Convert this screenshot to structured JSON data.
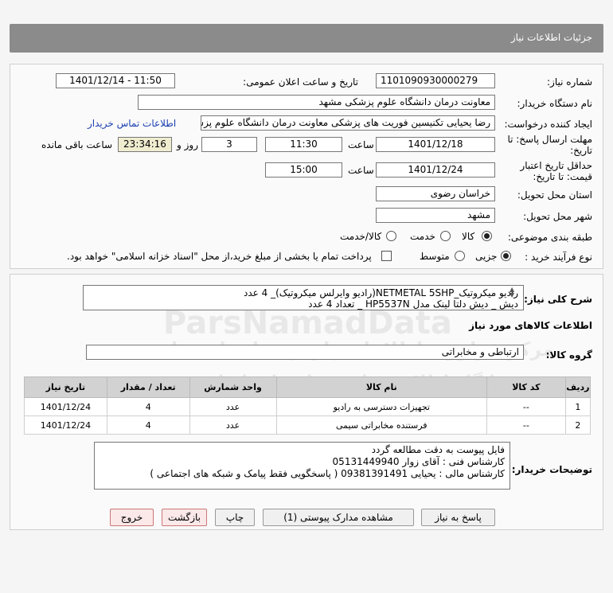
{
  "header": {
    "title": "جزئیات اطلاعات نیاز"
  },
  "form": {
    "need_number_label": "شماره نیاز:",
    "need_number": "1101090930000279",
    "announce_label": "تاریخ و ساعت اعلان عمومی:",
    "announce_value": "1401/12/14 - 11:50",
    "buyer_label": "نام دستگاه خریدار:",
    "buyer_value": "معاونت درمان دانشگاه علوم پزشکی مشهد",
    "creator_label": "ایجاد کننده درخواست:",
    "creator_value": "رضا یحیایی تکنیسین فوریت های پزشکی معاونت درمان دانشگاه علوم پزشکی م",
    "contact_link": "اطلاعات تماس خریدار",
    "deadline_label_1": "مهلت ارسال پاسخ: تا",
    "deadline_label_2": "تاریخ:",
    "deadline_date": "1401/12/18",
    "time_label": "ساعت",
    "deadline_time": "11:30",
    "days_value": "3",
    "days_label": "روز و",
    "remaining_time": "23:34:16",
    "remaining_label": "ساعت باقی مانده",
    "validity_label_1": "حداقل تاریخ اعتبار",
    "validity_label_2": "قیمت: تا تاریخ:",
    "validity_date": "1401/12/24",
    "validity_time_label": "ساعت",
    "validity_time": "15:00",
    "province_label": "استان محل تحویل:",
    "province_value": "خراسان رضوی",
    "city_label": "شهر محل تحویل:",
    "city_value": "مشهد",
    "category_label": "طبقه بندی موضوعی:",
    "category_options": [
      "کالا",
      "خدمت",
      "کالا/خدمت"
    ],
    "process_label": "نوع فرآیند خرید :",
    "process_options": [
      "جزیی",
      "متوسط"
    ],
    "payment_text": "پرداخت تمام یا بخشی از مبلغ خرید،از محل \"اسناد خزانه اسلامی\" خواهد بود."
  },
  "summary": {
    "label": "شرح کلی نیاز:",
    "line1": "رادیو میکروتیک_NETMETAL 5SHP(رادیو وایرلس میکروتیک)_ 4 عدد",
    "line2": "دیش _ دیش دلتا لینک مدل HP5537N _ تعداد 4 عدد"
  },
  "goods": {
    "section_title": "اطلاعات کالاهای مورد نیاز",
    "group_label": "گروه کالا:",
    "group_value": "ارتباطی و مخابراتی",
    "columns": [
      "ردیف",
      "کد کالا",
      "نام کالا",
      "واحد شمارش",
      "تعداد / مقدار",
      "تاریخ نیاز"
    ],
    "rows": [
      [
        "1",
        "--",
        "تجهیزات دسترسی به رادیو",
        "عدد",
        "4",
        "1401/12/24"
      ],
      [
        "2",
        "--",
        "فرستنده مخابراتی سیمی",
        "عدد",
        "4",
        "1401/12/24"
      ]
    ]
  },
  "buyer_notes": {
    "label": "توضیحات خریدار:",
    "line1": "فایل پیوست به دقت مطالعه گردد",
    "line2": "کارشناس فنی : آقای زوار 05131449940",
    "line3": "کارشناس مالی : یحیایی 09381391491 ( پاسخگویی فقط پیامک و شبکه های اجتماعی )"
  },
  "buttons": {
    "reply": "پاسخ به نیاز",
    "attachments": "مشاهده مدارک پیوستی (1)",
    "print": "چاپ",
    "back": "بازگشت",
    "exit": "خروج"
  },
  "watermark": {
    "brand": "ParsNamadData",
    "line1": "مرکز فراوری اطلاعات پارس نماد داده ها",
    "line2": "پایگاه اطلاع رسانی مناقصات ایران",
    "phone": "۰۲۱-۸۸۳۴۹۶۷۰-۵"
  }
}
